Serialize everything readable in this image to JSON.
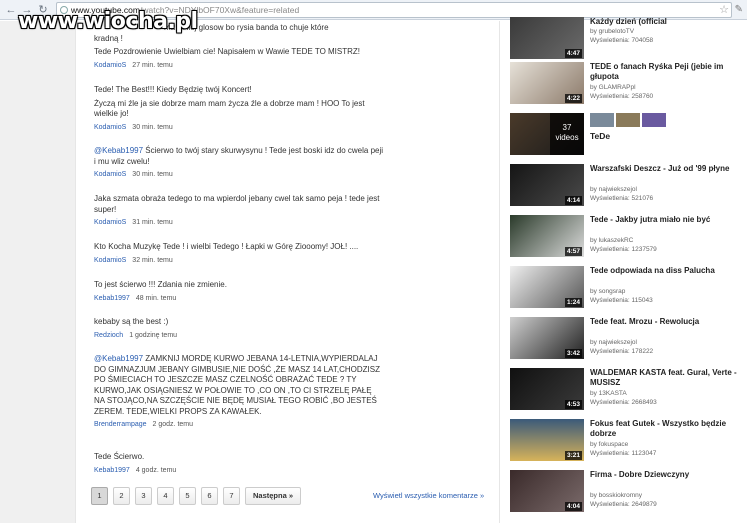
{
  "browser": {
    "url_host": "www.youtube.com",
    "url_rest": "/watch?v=NDYlbOF70Xw&feature=related"
  },
  "watermark": "www.wiocha.pl",
  "comments": [
    {
      "lines": [
        "ma mniej glosow bo rysia banda to chuje które",
        "kradną !"
      ],
      "text2": "Tede Pozdrowienie Uwielbiam cie! Napisałem w Wawie TEDE TO MISTRZ!",
      "user": "KodamioS",
      "time": "27 min. temu"
    },
    {
      "text": "Tede! The Best!!! Kiedy Będzię twój Koncert!",
      "text2": "Życzą mi źle ja sie dobrze mam mam życza źle a dobrze mam ! HOO To jest wielkie jo!",
      "user": "KodamioS",
      "time": "30 min. temu"
    },
    {
      "mention": "@Kebab1997",
      "text": " Ścierwo to twój stary skurwysynu ! Tede jest boski idz do cwela peji i mu wliz cwelu!",
      "user": "KodamioS",
      "time": "30 min. temu"
    },
    {
      "text": "Jaka szmata obraża tedego to ma wpierdol jebany cwel tak samo peja ! tede jest super!",
      "user": "KodamioS",
      "time": "31 min. temu"
    },
    {
      "text": "Kto Kocha Muzykę Tede ! i wielbi Tedego ! Łapki w Górę Ziooomy! JOŁ! ....",
      "user": "KodamioS",
      "time": "32 min. temu"
    },
    {
      "text": "To jest ścierwo !!! Zdania nie zmienie.",
      "user": "Kebab1997",
      "time": "48 min. temu"
    },
    {
      "text": "kebaby są the best :)",
      "user": "Redzioch",
      "time": "1 godzinę temu"
    },
    {
      "mention": "@Kebab1997",
      "text": " ZAMKNIJ MORDĘ KURWO JEBANA 14-LETNIA,WYPIERDALAJ DO GIMNAZJUM JEBANY GIMBUSIE,NIE DOŚĆ ,ŻE MASZ 14 LAT,CHODZISZ PO ŚMIECIACH TO JESZCZE MASZ CZELNOŚĆ OBRAŻAĆ TEDE ? TY KURWO,JAK OSIĄGNIESZ W POŁOWIE TO ,CO ON ,TO CI STRZELĘ PAŁĘ NA STOJĄCO,NA SZCZĘŚCIE NIE BĘDĘ MUSIAŁ TEGO ROBIĆ ,BO JESTEŚ ZEREM. TEDE,WIELKI PROPS ZA KAWAŁEK.",
      "user": "Brenderrampage",
      "time": "2 godz. temu"
    },
    {
      "text": "Tede Ścierwo.",
      "user": "Kebab1997",
      "time": "4 godz. temu"
    }
  ],
  "pagination": {
    "pages": [
      "1",
      "2",
      "3",
      "4",
      "5",
      "6",
      "7"
    ],
    "next_label": "Następna »",
    "view_all": "Wyświetl wszystkie komentarze »"
  },
  "playlist": {
    "count": "37",
    "count_label": "videos",
    "title": "TeDe"
  },
  "videos": [
    {
      "title": "Każdy dzień (official",
      "by": "by grubelotoTV",
      "views": "Wyświetlenia: 704058",
      "duration": "4:47",
      "colors": [
        "#3a3a3a",
        "#6b6b6b"
      ]
    },
    {
      "title": "TEDE o fanach Ryśka Peji (jebie im głupota",
      "by": "by GLAMRAPpl",
      "views": "Wyświetlenia: 258760",
      "duration": "4:22",
      "colors": [
        "#d9d4cc",
        "#8c7a6a"
      ]
    },
    {
      "title": "Warszafski Deszcz - Już od '99 płyne",
      "by": "by najwiekszejol",
      "views": "Wyświetlenia: 521076",
      "duration": "4:14",
      "colors": [
        "#151515",
        "#4a4a4a"
      ]
    },
    {
      "title": "Tede - Jakby jutra miało nie być",
      "by": "by lukaszekRC",
      "views": "Wyświetlenia: 1237579",
      "duration": "4:57",
      "colors": [
        "#2a3a2a",
        "#e8e8e8"
      ]
    },
    {
      "title": "Tede odpowiada na diss Palucha",
      "by": "by songsrap",
      "views": "Wyświetlenia: 115043",
      "duration": "1:24",
      "colors": [
        "#efefef",
        "#555"
      ]
    },
    {
      "title": "Tede feat. Mrozu - Rewolucja",
      "by": "by najwiekszejol",
      "views": "Wyświetlenia: 178222",
      "duration": "3:42",
      "colors": [
        "#cfcfcf",
        "#202020"
      ]
    },
    {
      "title": "WALDEMAR KASTA feat. Gural, Verte - MUSISZ",
      "by": "by 13KASTA",
      "views": "Wyświetlenia: 2668493",
      "duration": "4:53",
      "colors": [
        "#101010",
        "#3a3a3a"
      ]
    },
    {
      "title": "Fokus feat Gutek - Wszystko będzie dobrze",
      "by": "by fokuspace",
      "views": "Wyświetlenia: 1123047",
      "duration": "3:21",
      "colors": [
        "#d7b35a",
        "#3b5a7a"
      ]
    },
    {
      "title": "Firma - Dobre Dziewczyny",
      "by": "by bosskiokromny",
      "views": "Wyświetlenia: 2649879",
      "duration": "4:04",
      "colors": [
        "#3a2a2a",
        "#7a6a6a"
      ]
    }
  ]
}
